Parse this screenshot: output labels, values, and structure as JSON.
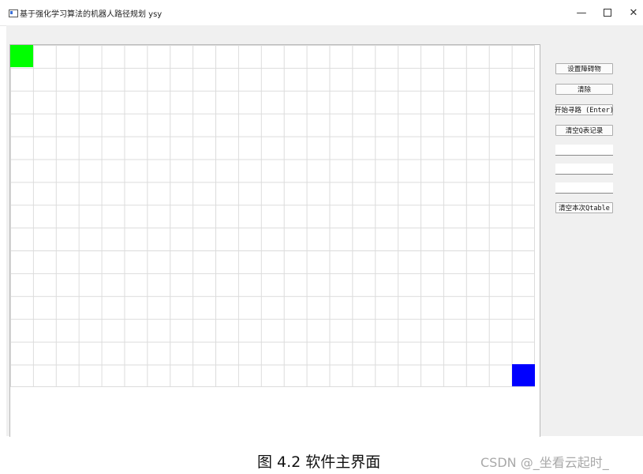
{
  "window": {
    "title": "基于强化学习算法的机器人路径规划 ysy",
    "minimize": "—",
    "close": "✕"
  },
  "grid": {
    "start_color": "#00ff00",
    "goal_color": "#0000ff"
  },
  "panel": {
    "buttons": [
      {
        "label": "设置障碍物"
      },
      {
        "label": "清除"
      },
      {
        "label": "开始寻路 (Enter)"
      },
      {
        "label": "清空Q表记录"
      }
    ],
    "fields": [
      {
        "value": ""
      },
      {
        "value": ""
      },
      {
        "value": ""
      }
    ],
    "clear_qtable": "清空本次Qtable"
  },
  "caption": "图 4.2  软件主界面",
  "watermark": "CSDN @_坐看云起时_"
}
